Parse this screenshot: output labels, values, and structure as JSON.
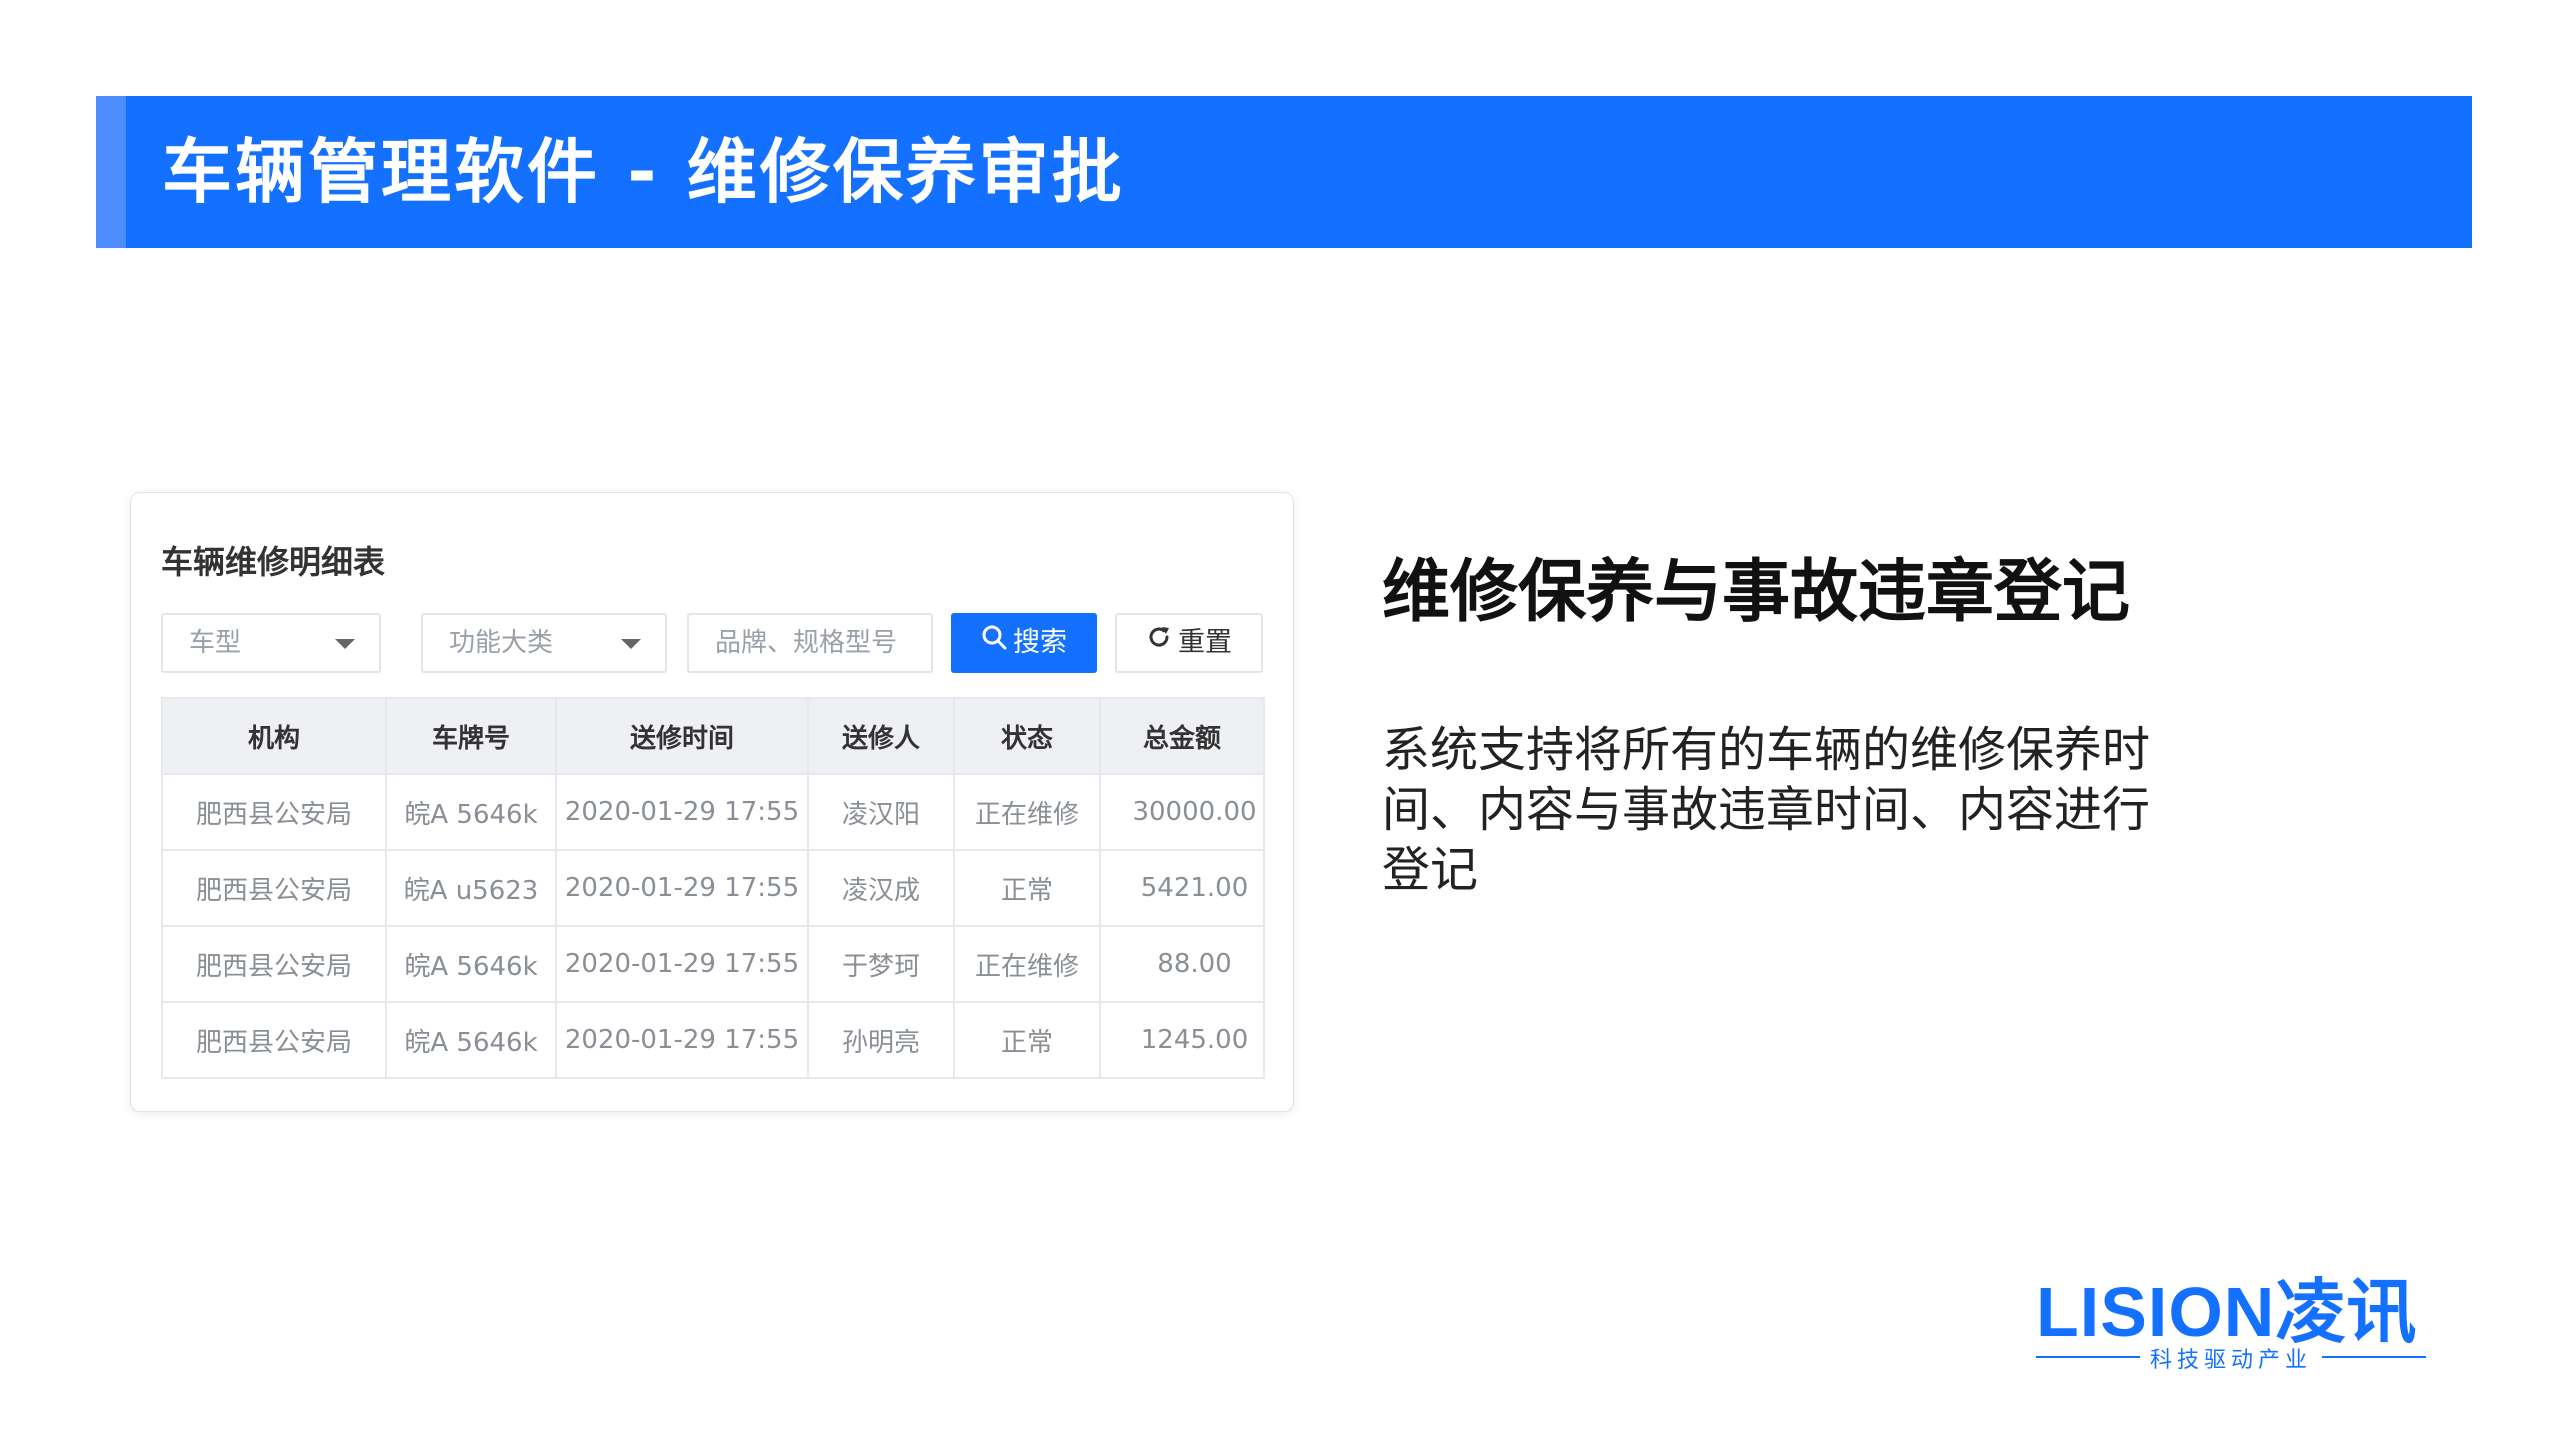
{
  "banner": {
    "title": "车辆管理软件 - 维修保养审批"
  },
  "card": {
    "title": "车辆维修明细表",
    "filters": {
      "vehicle_type": {
        "placeholder": "车型"
      },
      "function_category": {
        "placeholder": "功能大类"
      },
      "brand_model": {
        "placeholder": "品牌、规格型号"
      }
    },
    "buttons": {
      "search": "搜索",
      "reset": "重置"
    },
    "table": {
      "headers": [
        "机构",
        "车牌号",
        "送修时间",
        "送修人",
        "状态",
        "总金额"
      ],
      "rows": [
        {
          "org": "肥西县公安局",
          "plate": "皖A 5646k",
          "time": "2020-01-29 17:55",
          "person": "凌汉阳",
          "status": "正在维修",
          "amount": "30000.00"
        },
        {
          "org": "肥西县公安局",
          "plate": "皖A u5623",
          "time": "2020-01-29 17:55",
          "person": "凌汉成",
          "status": "正常",
          "amount": "5421.00"
        },
        {
          "org": "肥西县公安局",
          "plate": "皖A 5646k",
          "time": "2020-01-29 17:55",
          "person": "于梦珂",
          "status": "正在维修",
          "amount": "88.00"
        },
        {
          "org": "肥西县公安局",
          "plate": "皖A 5646k",
          "time": "2020-01-29 17:55",
          "person": "孙明亮",
          "status": "正常",
          "amount": "1245.00"
        }
      ]
    }
  },
  "section": {
    "title": "维修保养与事故违章登记",
    "description": "系统支持将所有的车辆的维修保养时间、内容与事故违章时间、内容进行登记"
  },
  "logo": {
    "brand": "LISION凌讯",
    "slogan": "科技驱动产业"
  },
  "colors": {
    "primary": "#1470ff",
    "status_repair": "#f5223d",
    "time_text": "#2f7bf2"
  },
  "icons": {
    "dropdown": "chevron-down-icon",
    "search": "search-icon",
    "reset": "refresh-icon"
  }
}
